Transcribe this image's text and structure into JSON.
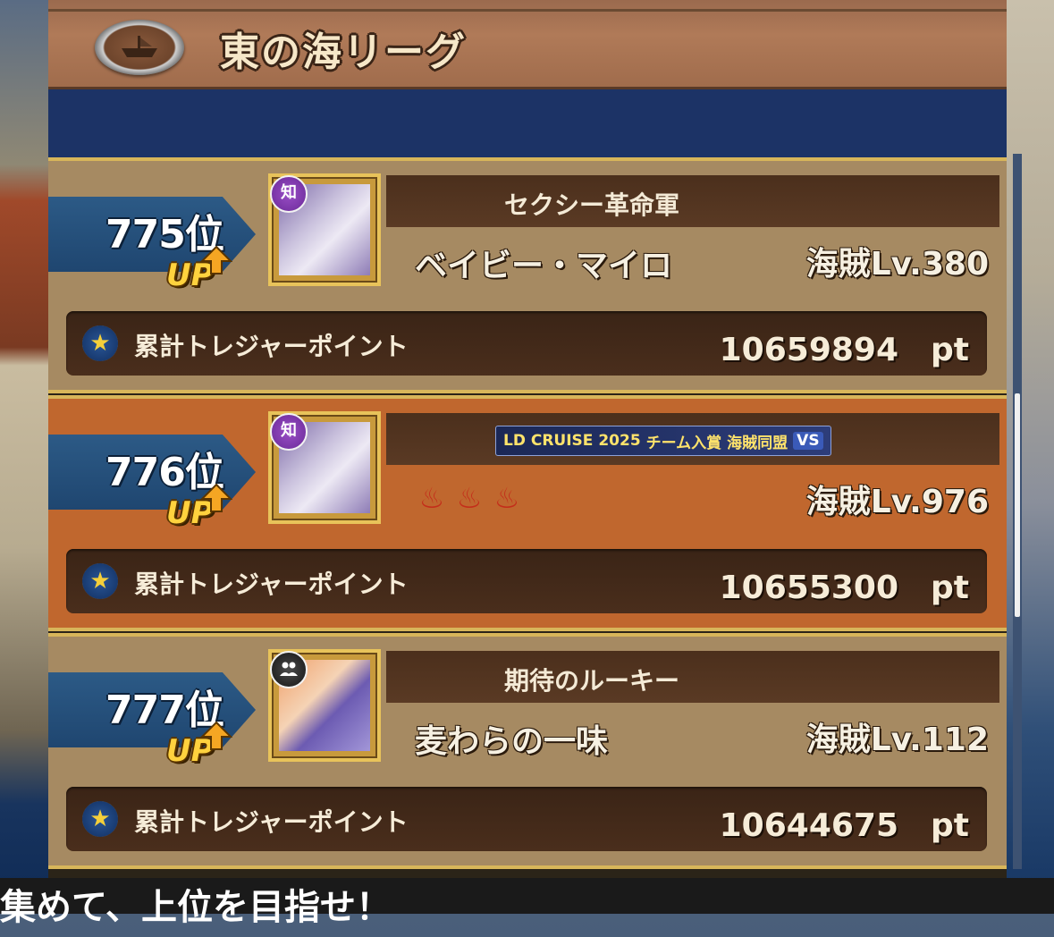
{
  "header": {
    "title": "東の海リーグ"
  },
  "rows": [
    {
      "rank": "775位",
      "up_label": "UP",
      "type_icon": "知",
      "crew": "セクシー革命軍",
      "name": "ベイビー・マイロ",
      "level": "海賊Lv.380",
      "points_label": "累計トレジャーポイント",
      "points": "10659894　pt"
    },
    {
      "rank": "776位",
      "up_label": "UP",
      "type_icon": "知",
      "crew_banner": {
        "text1": "LD CRUISE 2025",
        "text2": "チーム入賞",
        "text3": "海賊同盟",
        "vs": "VS"
      },
      "flames": [
        "♨",
        "♨",
        "♨"
      ],
      "level": "海賊Lv.976",
      "points_label": "累計トレジャーポイント",
      "points": "10655300　pt"
    },
    {
      "rank": "777位",
      "up_label": "UP",
      "type_icon": "dual-character-icon",
      "crew": "期待のルーキー",
      "name": "麦わらの一味",
      "level": "海賊Lv.112",
      "points_label": "累計トレジャーポイント",
      "points": "10644675　pt"
    }
  ],
  "footer": {
    "text": "集めて、上位を目指せ！"
  },
  "colors": {
    "row_tan": "#a68a62",
    "row_highlight": "#c0672e",
    "gold_border": "#d8b65a",
    "header_brown": "#b07a58"
  }
}
